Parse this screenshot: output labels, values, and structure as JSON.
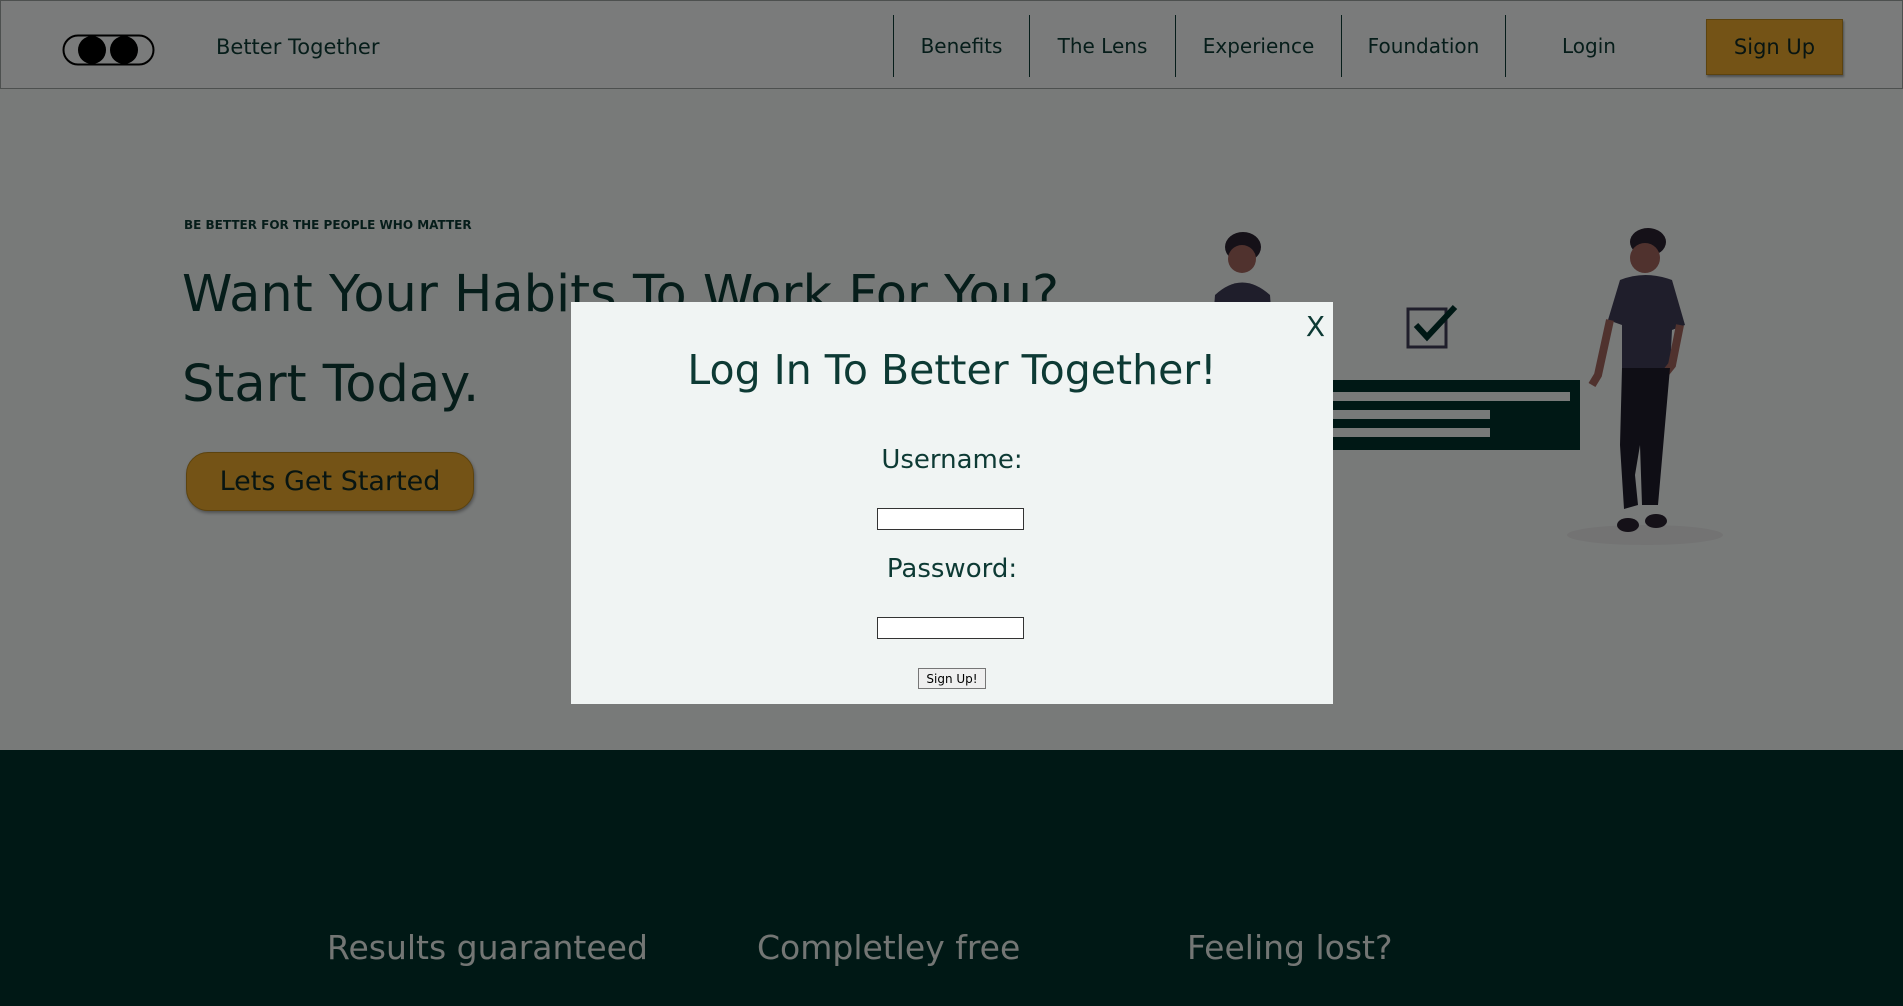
{
  "nav": {
    "brand": "Better Together",
    "links": [
      "Benefits",
      "The Lens",
      "Experience",
      "Foundation"
    ],
    "login": "Login",
    "signup": "Sign Up"
  },
  "hero": {
    "eyebrow": "BE BETTER FOR THE PEOPLE WHO MATTER",
    "headline_1": "Want Your Habits To Work For You?",
    "headline_2": "Start Today.",
    "cta": "Lets Get Started"
  },
  "features": [
    "Results guaranteed",
    "Completley free",
    "Feeling lost?"
  ],
  "modal": {
    "close": "X",
    "title": "Log In To Better Together!",
    "username_label": "Username:",
    "username_value": "",
    "password_label": "Password:",
    "password_value": "",
    "submit": "Sign Up!"
  },
  "colors": {
    "brand_dark": "#0d3a34",
    "accent": "#e8a62c",
    "band": "#00312a",
    "page_bg": "#f0f4f3"
  }
}
